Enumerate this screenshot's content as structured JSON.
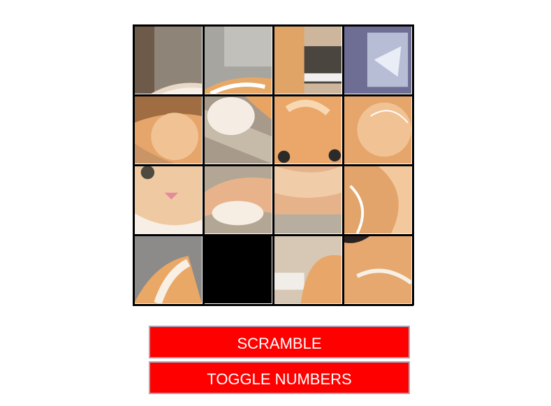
{
  "puzzle": {
    "grid_size": 4,
    "empty_tile": {
      "row": 3,
      "col": 1
    },
    "image_subject": "orange-kitten-photo",
    "colors": {
      "empty": "#000000",
      "grid_lines": "#000000",
      "button_bg": "#ff0000",
      "button_text": "#ffffff",
      "button_border": "#a7a7b9"
    }
  },
  "buttons": {
    "scramble_label": "SCRAMBLE",
    "toggle_numbers_label": "TOGGLE NUMBERS"
  }
}
